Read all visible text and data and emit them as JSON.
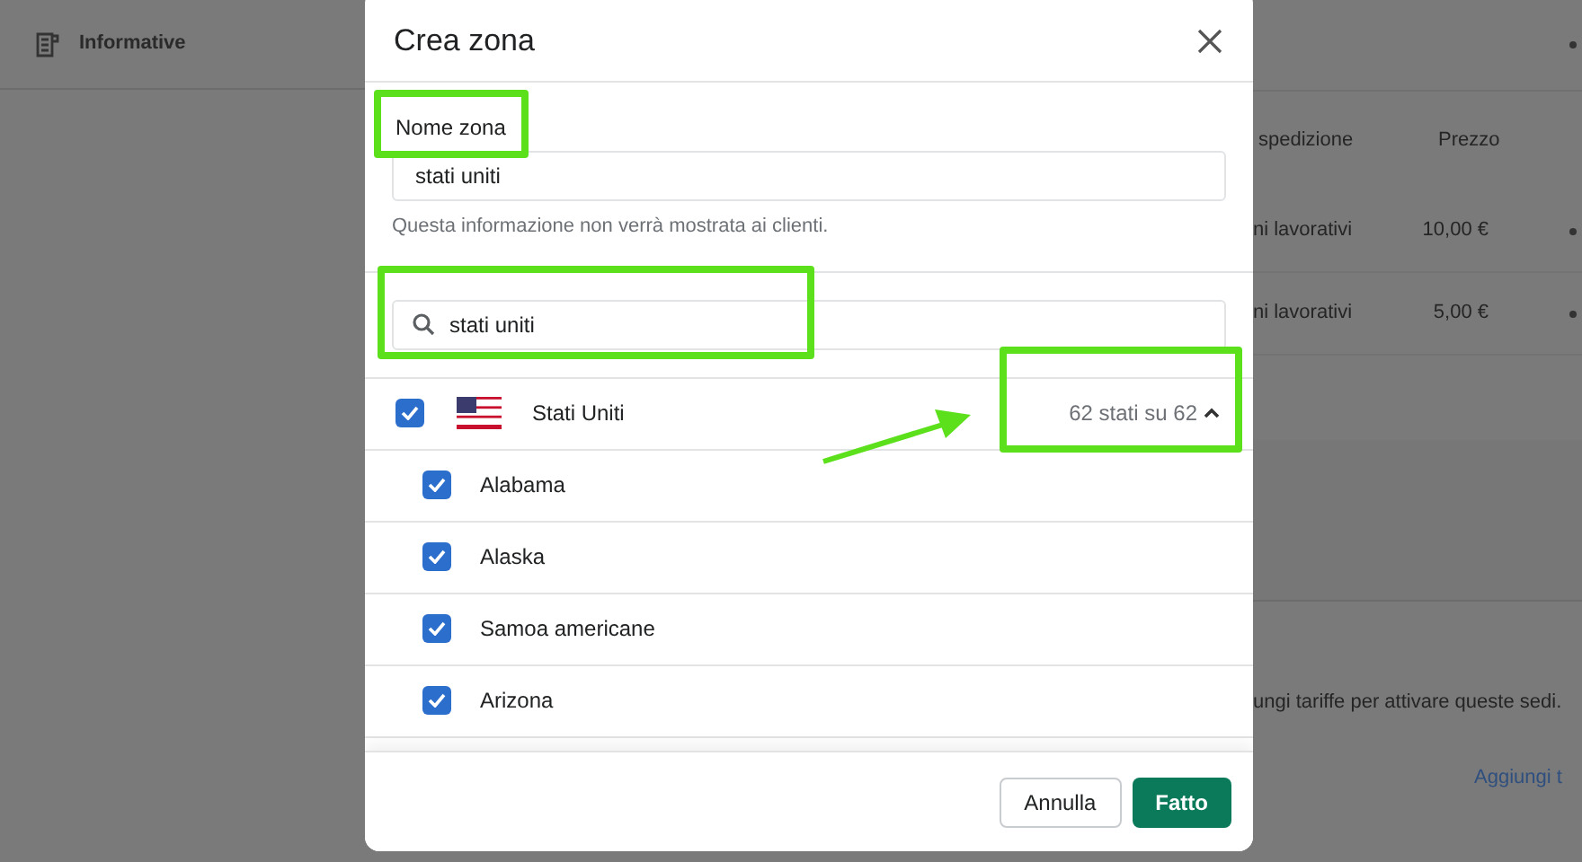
{
  "background_page": {
    "section_title": "Informative",
    "table": {
      "columns": [
        "spedizione",
        "Prezzo"
      ],
      "rows": [
        {
          "time": "ni lavorativi",
          "price": "10,00 €"
        },
        {
          "time": "ni lavorativi",
          "price": "5,00 €"
        }
      ]
    },
    "notice": "ungi tariffe per attivare queste sedi.",
    "link": "Aggiungi t"
  },
  "dialog": {
    "title": "Crea zona",
    "name_field": {
      "label": "Nome zona",
      "value": "stati uniti",
      "help": "Questa informazione non verrà mostrata ai clienti."
    },
    "search": {
      "value": "stati uniti"
    },
    "country": {
      "name": "Stati Uniti",
      "checked": true,
      "count": "62 stati su 62",
      "expanded": true
    },
    "states": [
      {
        "name": "Alabama",
        "checked": true
      },
      {
        "name": "Alaska",
        "checked": true
      },
      {
        "name": "Samoa americane",
        "checked": true
      },
      {
        "name": "Arizona",
        "checked": true
      }
    ],
    "buttons": [
      {
        "label": "Annulla",
        "kind": "secondary"
      },
      {
        "label": "Fatto",
        "kind": "primary"
      }
    ]
  }
}
